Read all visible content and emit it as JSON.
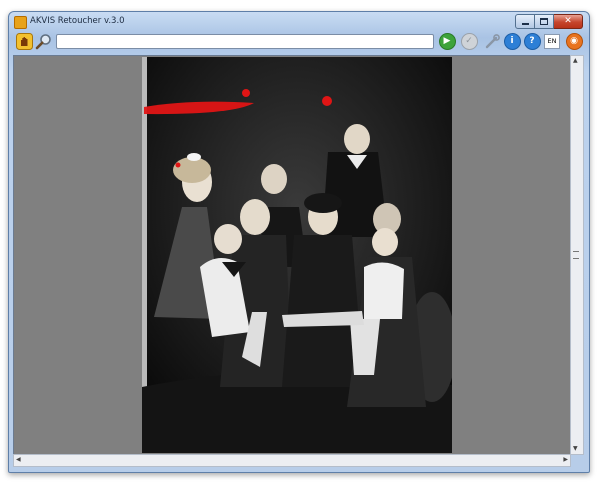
{
  "window": {
    "title": "AKVIS Retoucher v.3.0",
    "controls": {
      "minimize": "minimize",
      "maximize": "maximize",
      "close": "close"
    }
  },
  "toolbar": {
    "path_value": "",
    "language": "EN",
    "icons": [
      "hand-icon",
      "magnifier-icon",
      "run-icon",
      "stop-icon",
      "settings-icon",
      "info-icon",
      "help-icon",
      "language-icon",
      "preferences-icon"
    ]
  },
  "colors": {
    "canvas_bg": "#808080",
    "selection_stroke": "#e01515",
    "run_green": "#3da33a",
    "info_blue": "#2d7fd6",
    "prefs_orange": "#e8731f"
  },
  "photo": {
    "subject": "black-and-white family portrait",
    "defects_marked": 4
  }
}
